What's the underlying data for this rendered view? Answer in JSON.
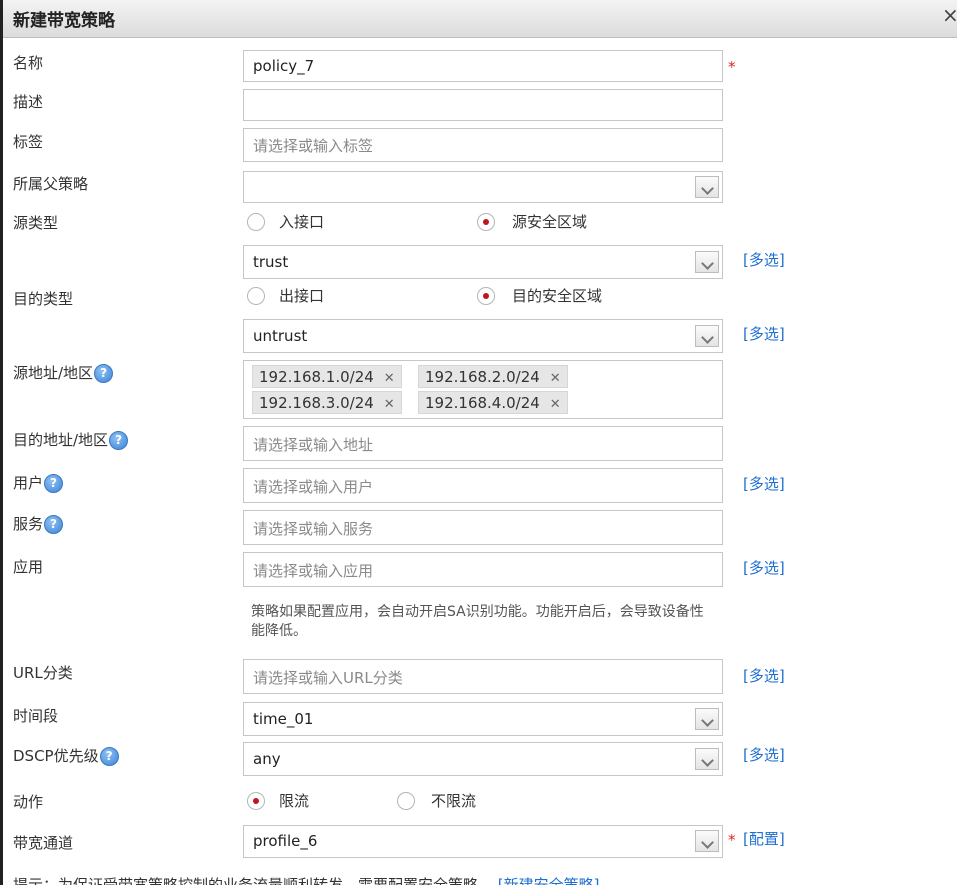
{
  "dialog": {
    "title": "新建带宽策略"
  },
  "labels": {
    "name": "名称",
    "desc": "描述",
    "tag": "标签",
    "parent": "所属父策略",
    "src_type": "源类型",
    "dst_type": "目的类型",
    "src_addr": "源地址/地区",
    "dst_addr": "目的地址/地区",
    "user": "用户",
    "service": "服务",
    "app": "应用",
    "url_cat": "URL分类",
    "time": "时间段",
    "dscp": "DSCP优先级",
    "action": "动作",
    "channel": "带宽通道"
  },
  "fields": {
    "name": "policy_7",
    "desc": "",
    "tag_placeholder": "请选择或输入标签",
    "parent": "",
    "src_zone": "trust",
    "dst_zone": "untrust",
    "dst_addr_placeholder": "请选择或输入地址",
    "user_placeholder": "请选择或输入用户",
    "service_placeholder": "请选择或输入服务",
    "app_placeholder": "请选择或输入应用",
    "url_placeholder": "请选择或输入URL分类",
    "time": "time_01",
    "dscp": "any",
    "channel": "profile_6"
  },
  "radios": {
    "src_if": "入接口",
    "src_zone": "源安全区域",
    "dst_if": "出接口",
    "dst_zone": "目的安全区域",
    "limit": "限流",
    "nolimit": "不限流"
  },
  "src_addrs": [
    "192.168.1.0/24",
    "192.168.2.0/24",
    "192.168.3.0/24",
    "192.168.4.0/24"
  ],
  "links": {
    "multi": "[多选]",
    "config": "[配置]",
    "new_sec": "[新建安全策略]"
  },
  "app_note": "策略如果配置应用，会自动开启SA识别功能。功能开启后，会导致设备性能降低。",
  "footer_text": "提示：为保证受带宽策略控制的业务流量顺利转发，需要配置安全策略。",
  "help_glyph": "?",
  "required_mark": "*",
  "tag_remove_glyph": "✕",
  "close_glyph": "×"
}
